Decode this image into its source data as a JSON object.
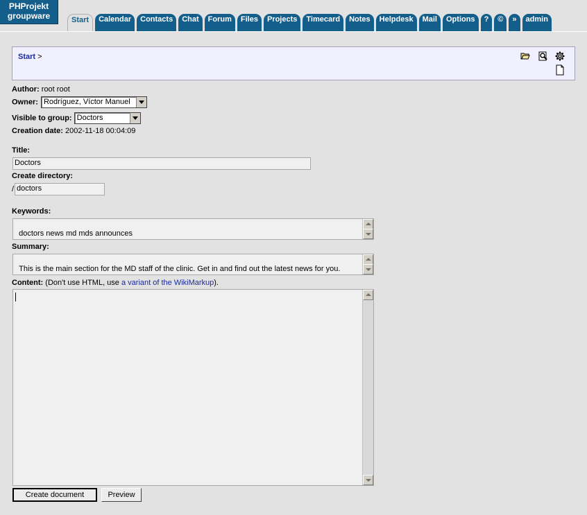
{
  "app": {
    "logo_line1": "PHProjekt",
    "logo_line2": "groupware"
  },
  "tabs": [
    {
      "label": "Start",
      "active": true
    },
    {
      "label": "Calendar"
    },
    {
      "label": "Contacts"
    },
    {
      "label": "Chat"
    },
    {
      "label": "Forum"
    },
    {
      "label": "Files"
    },
    {
      "label": "Projects"
    },
    {
      "label": "Timecard"
    },
    {
      "label": "Notes"
    },
    {
      "label": "Helpdesk"
    },
    {
      "label": "Mail"
    },
    {
      "label": "Options"
    },
    {
      "label": "?"
    },
    {
      "label": "©"
    },
    {
      "label": "»"
    },
    {
      "label": "admin"
    }
  ],
  "breadcrumb": {
    "start": "Start",
    "separator": ">"
  },
  "toolbar_icons": [
    "folder-open-icon",
    "search-icon",
    "gear-icon",
    "new-document-icon"
  ],
  "meta": {
    "author_label": "Author:",
    "author_value": "root root",
    "owner_label": "Owner:",
    "owner_value": "Rodríguez, Víctor Manuel",
    "group_label": "Visible to group:",
    "group_value": "Doctors",
    "created_label": "Creation date:",
    "created_value": "2002-11-18 00:04:09"
  },
  "form": {
    "title_label": "Title:",
    "title_value": "Doctors",
    "directory_label": "Create directory:",
    "directory_prefix": "/",
    "directory_value": "doctors",
    "keywords_label": "Keywords:",
    "keywords_value": "doctors news md mds announces",
    "summary_label": "Summary:",
    "summary_value": "This is the main section for the MD staff of the clinic. Get in and find out the latest news for you.",
    "content_label": "Content:",
    "content_note_before": "(Don't use HTML, use ",
    "content_note_link": "a variant of the WikiMarkup",
    "content_note_after": ").",
    "content_value": ""
  },
  "buttons": {
    "create": "Create document",
    "preview": "Preview"
  },
  "colors": {
    "tab_blue": "#135e8b",
    "background": "#e2e2e2",
    "panel": "#f0f0ff",
    "link": "#1a2a9c"
  }
}
